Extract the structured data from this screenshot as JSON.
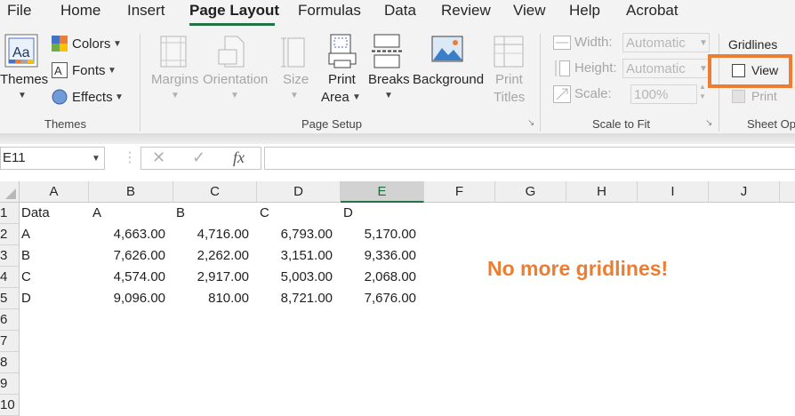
{
  "menu": {
    "items": [
      "File",
      "Home",
      "Insert",
      "Page Layout",
      "Formulas",
      "Data",
      "Review",
      "View",
      "Help",
      "Acrobat"
    ],
    "active": "Page Layout"
  },
  "ribbon": {
    "themes_group": {
      "label": "Themes",
      "themes_button": "Themes",
      "colors": "Colors",
      "fonts": "Fonts",
      "effects": "Effects"
    },
    "page_setup_group": {
      "label": "Page Setup",
      "margins": "Margins",
      "orientation": "Orientation",
      "size": "Size",
      "print_area_1": "Print",
      "print_area_2": "Area",
      "breaks": "Breaks",
      "background": "Background",
      "print_titles_1": "Print",
      "print_titles_2": "Titles"
    },
    "scale_group": {
      "label": "Scale to Fit",
      "width_label": "Width:",
      "width_value": "Automatic",
      "height_label": "Height:",
      "height_value": "Automatic",
      "scale_label": "Scale:",
      "scale_value": "100%"
    },
    "sheet_options_group": {
      "label": "Sheet Op",
      "gridlines": "Gridlines",
      "view": "View",
      "view_checked": false,
      "print": "Print",
      "highlight_color": "#ed7d31"
    }
  },
  "formula_bar": {
    "name_box": "E11",
    "cancel_icon": "✕",
    "enter_icon": "✓",
    "fx": "fx",
    "content": ""
  },
  "grid": {
    "columns": [
      "A",
      "B",
      "C",
      "D",
      "E",
      "F",
      "G",
      "H",
      "I",
      "J"
    ],
    "selected_column": "E",
    "rows": [
      "1",
      "2",
      "3",
      "4",
      "5",
      "6",
      "7",
      "8",
      "9",
      "10"
    ],
    "header_row": [
      "Data",
      "A",
      "B",
      "C",
      "D"
    ],
    "data_rows": [
      [
        "A",
        "4,663.00",
        "4,716.00",
        "6,793.00",
        "5,170.00"
      ],
      [
        "B",
        "7,626.00",
        "2,262.00",
        "3,151.00",
        "9,336.00"
      ],
      [
        "C",
        "4,574.00",
        "2,917.00",
        "5,003.00",
        "2,068.00"
      ],
      [
        "D",
        "9,096.00",
        "810.00",
        "8,721.00",
        "7,676.00"
      ]
    ]
  },
  "callout": {
    "text": "No more gridlines!",
    "color": "#ed7d31"
  },
  "accent_color": "#217346"
}
